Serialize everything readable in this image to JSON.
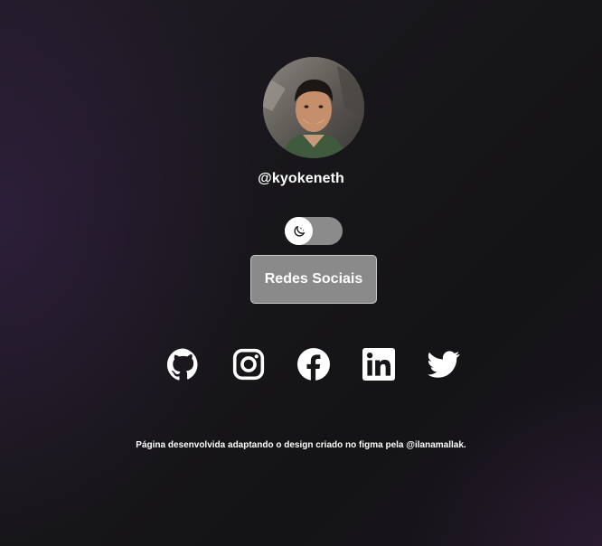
{
  "profile": {
    "username": "@kyokeneth",
    "avatar_alt": "profile photo"
  },
  "theme_toggle": {
    "state": "dark",
    "icon": "moon-icon"
  },
  "main_button": {
    "label": "Redes Sociais"
  },
  "social_links": [
    {
      "name": "GitHub",
      "icon": "github-icon"
    },
    {
      "name": "Instagram",
      "icon": "instagram-icon"
    },
    {
      "name": "Facebook",
      "icon": "facebook-icon"
    },
    {
      "name": "LinkedIn",
      "icon": "linkedin-icon"
    },
    {
      "name": "Twitter",
      "icon": "twitter-icon"
    }
  ],
  "footer": {
    "text": "Página desenvolvida adaptando o design criado no figma pela @ilanamallak."
  },
  "colors": {
    "background": "#161518",
    "accent_purple": "#3a224e",
    "toggle_track": "#8b8b8b",
    "button_bg": "#8a8a8a",
    "button_border": "#c9c9c9",
    "text": "#ffffff"
  }
}
